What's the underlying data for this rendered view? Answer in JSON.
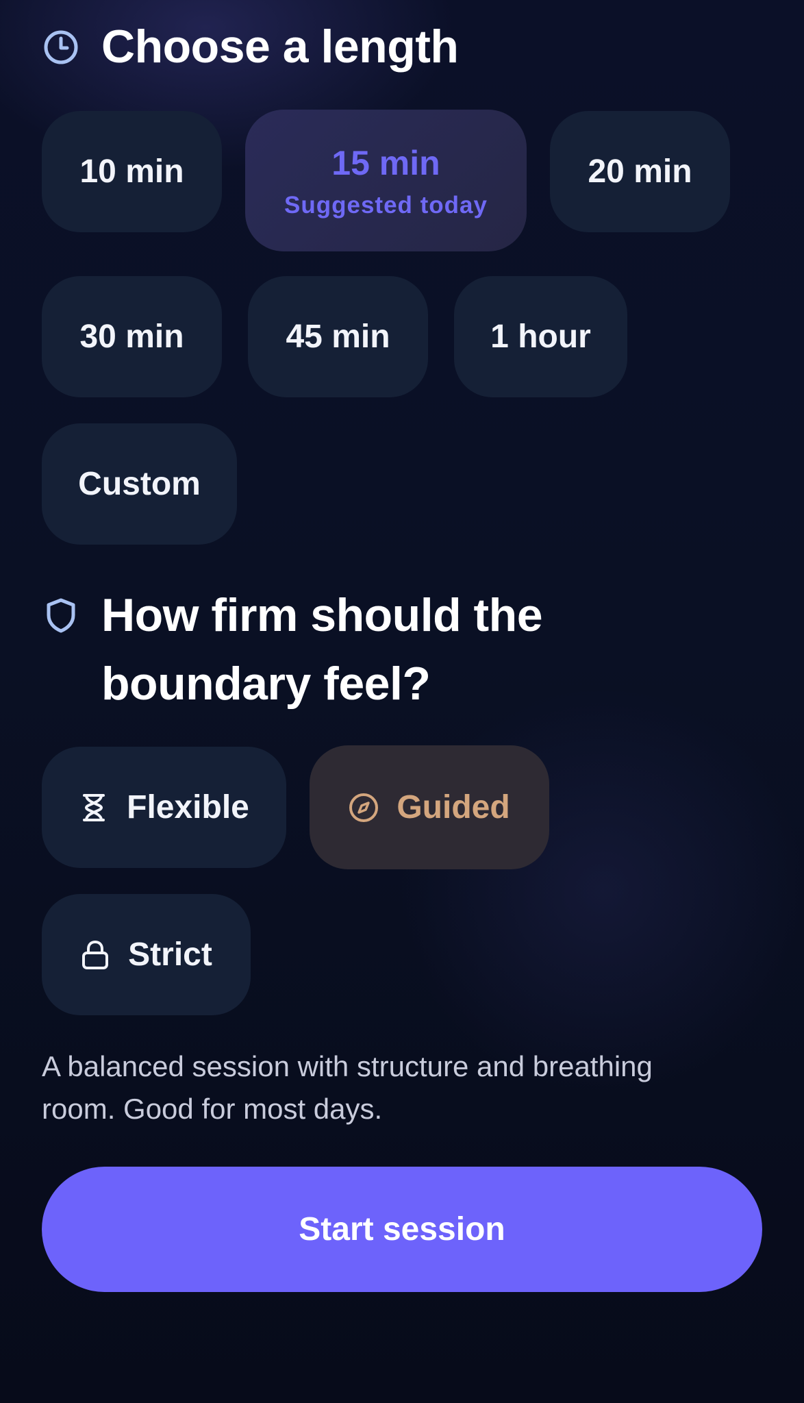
{
  "length_section": {
    "title": "Choose a length",
    "icon": "clock-icon",
    "options": [
      {
        "label": "10 min"
      },
      {
        "label": "15 min",
        "note": "Suggested today",
        "selected": true
      },
      {
        "label": "20 min"
      },
      {
        "label": "30 min"
      },
      {
        "label": "45 min"
      },
      {
        "label": "1 hour"
      },
      {
        "label": "Custom"
      }
    ]
  },
  "boundary_section": {
    "title_line1": "How firm should the",
    "title_line2": "boundary feel?",
    "icon": "shield-icon",
    "options": [
      {
        "label": "Flexible",
        "icon": "hourglass-icon"
      },
      {
        "label": "Guided",
        "icon": "compass-icon",
        "selected": true
      },
      {
        "label": "Strict",
        "icon": "lock-icon"
      }
    ]
  },
  "description": "A balanced session with structure and breathing room. Good for most days.",
  "start_button_label": "Start session",
  "colors": {
    "accent": "#6d63fb",
    "guided_accent": "#d4a67e",
    "chip_bg": "#152036",
    "icon_tint": "#a9c2f2"
  }
}
